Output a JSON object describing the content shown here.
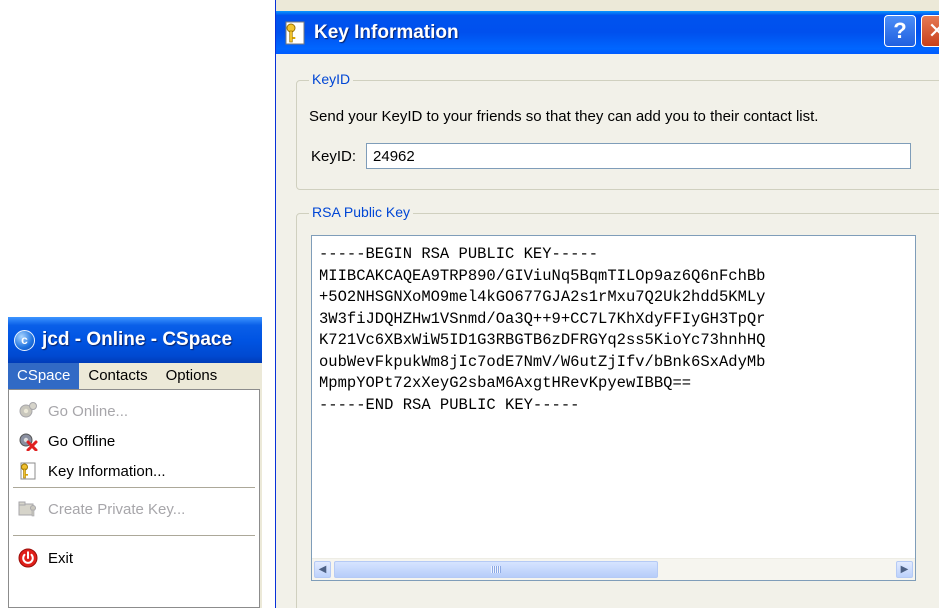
{
  "main_window": {
    "title": "jcd - Online - CSpace",
    "app_icon_letter": "c",
    "menubar": [
      {
        "label": "CSpace",
        "active": true
      },
      {
        "label": "Contacts",
        "active": false
      },
      {
        "label": "Options",
        "active": false
      }
    ],
    "dropdown": {
      "go_online": {
        "label": "Go Online...",
        "enabled": false,
        "icon": "network-gears-icon"
      },
      "go_offline": {
        "label": "Go Offline",
        "enabled": true,
        "icon": "disconnect-icon"
      },
      "key_information": {
        "label": "Key Information...",
        "enabled": true,
        "icon": "key-icon"
      },
      "create_private_key": {
        "label": "Create Private Key...",
        "enabled": false,
        "icon": "key-folder-icon"
      },
      "exit": {
        "label": "Exit",
        "enabled": true,
        "icon": "power-icon"
      }
    }
  },
  "dialog": {
    "title": "Key Information",
    "help_button": "?",
    "close_button": "✕",
    "keyid_group": {
      "label": "KeyID",
      "description": "Send your KeyID to your friends so that they can add you to their contact list.",
      "field_label": "KeyID:",
      "field_value": "24962"
    },
    "rsa_group": {
      "label": "RSA Public Key",
      "text": "-----BEGIN RSA PUBLIC KEY-----\nMIIBCAKCAQEA9TRP890/GIViuNq5BqmTILOp9az6Q6nFchBb\n+5O2NHSGNXoMO9mel4kGO677GJA2s1rMxu7Q2Uk2hdd5KMLy\n3W3fiJDQHZHw1VSnmd/Oa3Q++9+CC7L7KhXdyFFIyGH3TpQr\nK721Vc6XBxWiW5ID1G3RBGTB6zDFRGYq2ss5KioYc73hnhHQ\noubWevFkpukWm8jIc7odE7NmV/W6utZjIfv/bBnk6SxAdyMb\nMpmpYOPt72xXeyG2sbaM6AxgtHRevKpyewIBBQ==\n-----END RSA PUBLIC KEY-----"
    },
    "scrollbar": {
      "left_arrow": "◀",
      "right_arrow": "▶"
    }
  },
  "colors": {
    "xp_blue_title": "#0054e3",
    "menu_highlight": "#316ac5",
    "group_label": "#0046d5",
    "disabled_text": "#a7a6aa",
    "dialog_face": "#f2f1e9"
  }
}
